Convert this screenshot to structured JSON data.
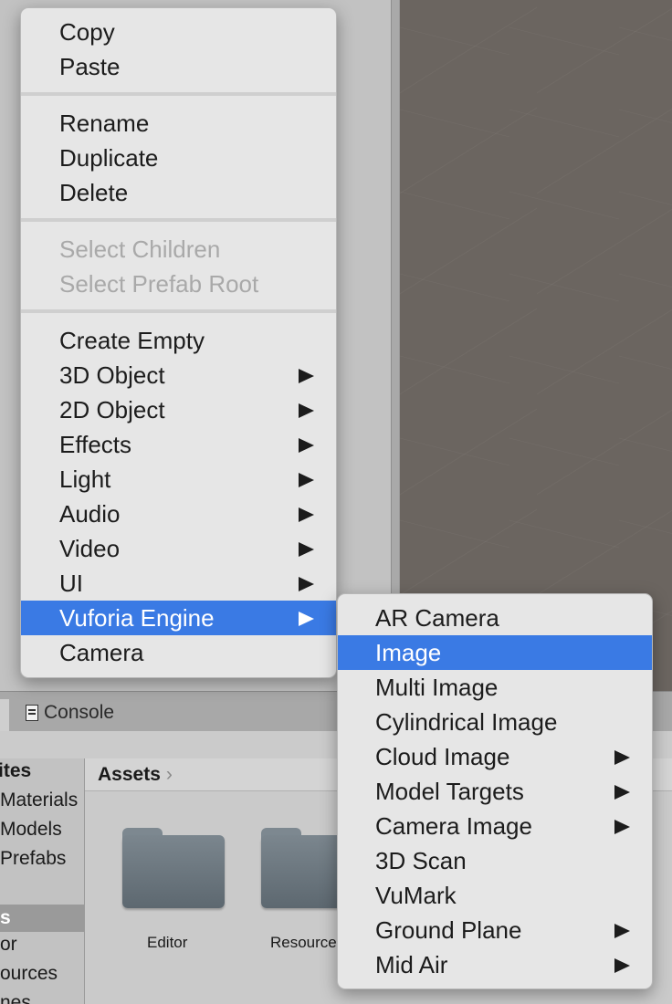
{
  "context_menu": {
    "group_clipboard": [
      "Copy",
      "Paste"
    ],
    "group_edit": [
      "Rename",
      "Duplicate",
      "Delete"
    ],
    "group_select": [
      "Select Children",
      "Select Prefab Root"
    ],
    "group_create": [
      {
        "label": "Create Empty",
        "submenu": false
      },
      {
        "label": "3D Object",
        "submenu": true
      },
      {
        "label": "2D Object",
        "submenu": true
      },
      {
        "label": "Effects",
        "submenu": true
      },
      {
        "label": "Light",
        "submenu": true
      },
      {
        "label": "Audio",
        "submenu": true
      },
      {
        "label": "Video",
        "submenu": true
      },
      {
        "label": "UI",
        "submenu": true
      },
      {
        "label": "Vuforia Engine",
        "submenu": true,
        "highlighted": true
      },
      {
        "label": "Camera",
        "submenu": false
      }
    ]
  },
  "vuforia_submenu": {
    "items": [
      {
        "label": "AR Camera",
        "submenu": false
      },
      {
        "label": "Image",
        "submenu": false,
        "highlighted": true
      },
      {
        "label": "Multi Image",
        "submenu": false
      },
      {
        "label": "Cylindrical Image",
        "submenu": false
      },
      {
        "label": "Cloud Image",
        "submenu": true
      },
      {
        "label": "Model Targets",
        "submenu": true
      },
      {
        "label": "Camera Image",
        "submenu": true
      },
      {
        "label": "3D Scan",
        "submenu": false
      },
      {
        "label": "VuMark",
        "submenu": false
      },
      {
        "label": "Ground Plane",
        "submenu": true
      },
      {
        "label": "Mid Air",
        "submenu": true
      }
    ]
  },
  "bottom_panel": {
    "console_tab": "Console",
    "tree": [
      "ites",
      "Materials",
      "Models",
      "Prefabs",
      "s",
      "or",
      "ources",
      "nes"
    ],
    "breadcrumb": "Assets",
    "breadcrumb_chevron": "›",
    "folders": [
      "Editor",
      "Resource"
    ]
  },
  "colors": {
    "highlight": "#3a7ae4",
    "menu_bg": "#e6e6e6",
    "scene_bg": "#6b6560",
    "folder": "#6c777f"
  },
  "icons": {
    "submenu_arrow": "triangle-right-icon",
    "console": "console-icon",
    "folder": "folder-icon"
  }
}
